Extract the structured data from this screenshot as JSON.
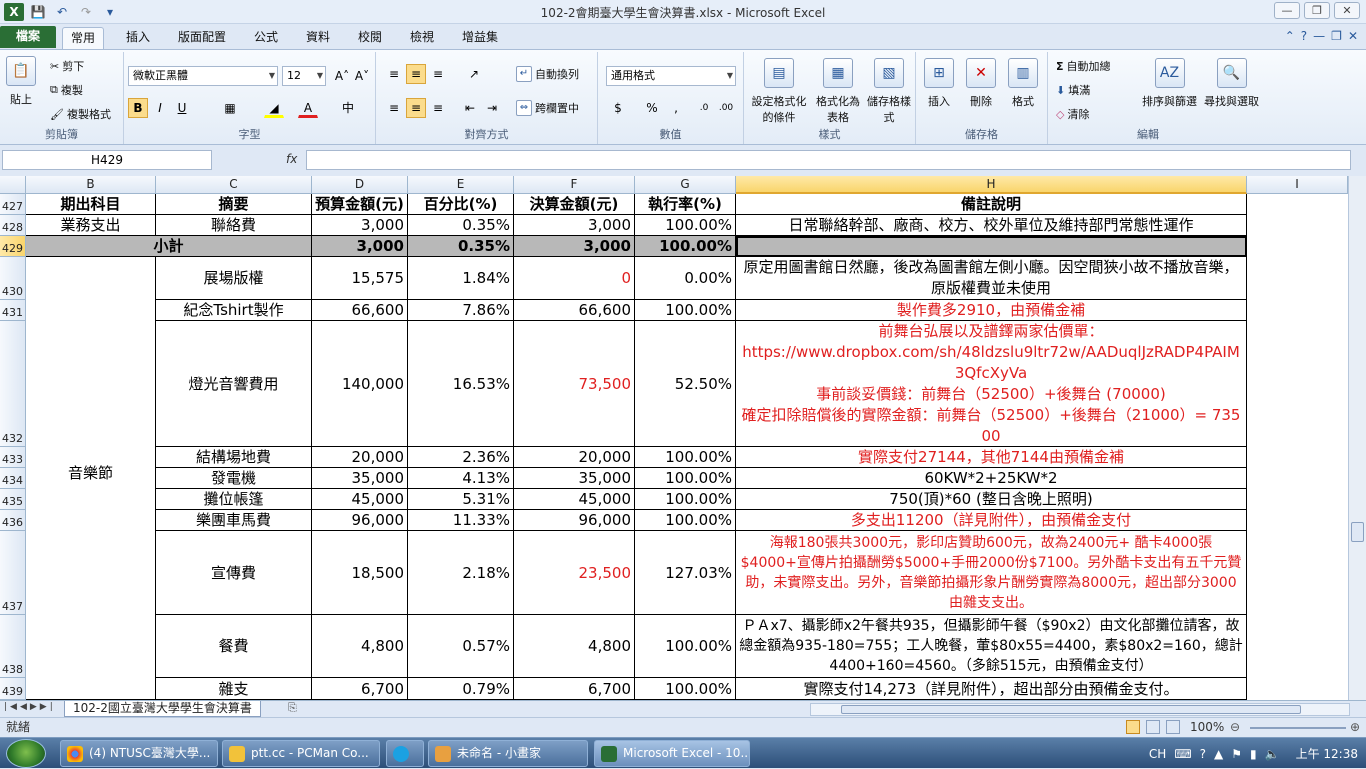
{
  "window": {
    "title": "102-2會期臺大學生會決算書.xlsx - Microsoft Excel"
  },
  "ribbon_tabs": [
    "檔案",
    "常用",
    "插入",
    "版面配置",
    "公式",
    "資料",
    "校閱",
    "檢視",
    "增益集"
  ],
  "ribbon": {
    "clipboard": {
      "paste": "貼上",
      "cut": "剪下",
      "copy": "複製",
      "format_painter": "複製格式",
      "label": "剪貼簿"
    },
    "font": {
      "name": "微軟正黑體",
      "size": "12",
      "label": "字型"
    },
    "alignment": {
      "wrap": "自動換列",
      "merge": "跨欄置中",
      "label": "對齊方式"
    },
    "number": {
      "format": "通用格式",
      "label": "數值"
    },
    "styles": {
      "conditional": "設定格式化的條件",
      "table": "格式化為表格",
      "cell": "儲存格樣式",
      "label": "樣式"
    },
    "cells": {
      "insert": "插入",
      "delete": "刪除",
      "format": "格式",
      "label": "儲存格"
    },
    "editing": {
      "autosum": "自動加總",
      "fill": "填滿",
      "clear": "清除",
      "sort": "排序與篩選",
      "find": "尋找與選取",
      "label": "編輯"
    }
  },
  "formula_bar": {
    "name_box": "H429",
    "fx": "fx",
    "value": ""
  },
  "columns": [
    "B",
    "C",
    "D",
    "E",
    "F",
    "G",
    "H",
    "I"
  ],
  "rows": {
    "r427": {
      "num": "427",
      "b": "期出科目",
      "c": "摘要",
      "d": "預算金額(元)",
      "e": "百分比(%)",
      "f": "決算金額(元)",
      "g": "執行率(%)",
      "h": "備註說明"
    },
    "r428": {
      "num": "428",
      "b": "業務支出",
      "c": "聯絡費",
      "d": "3,000",
      "e": "0.35%",
      "f": "3,000",
      "g": "100.00%",
      "h": "日常聯絡幹部、廠商、校方、校外單位及維持部門常態性運作"
    },
    "r429": {
      "num": "429",
      "bc": "小計",
      "d": "3,000",
      "e": "0.35%",
      "f": "3,000",
      "g": "100.00%",
      "h": ""
    },
    "r430": {
      "num": "430",
      "c": "展場版權",
      "d": "15,575",
      "e": "1.84%",
      "f": "0",
      "g": "0.00%",
      "h": "原定用圖書館日然廳，後改為圖書館左側小廳。因空間狹小故不播放音樂，原版權費並未使用"
    },
    "r431": {
      "num": "431",
      "c": "紀念Tshirt製作",
      "d": "66,600",
      "e": "7.86%",
      "f": "66,600",
      "g": "100.00%",
      "h": "製作費多2910，由預備金補"
    },
    "r432": {
      "num": "432",
      "c": "燈光音響費用",
      "d": "140,000",
      "e": "16.53%",
      "f": "73,500",
      "g": "52.50%",
      "h1": "前舞台弘展以及譜鐸兩家估價單：",
      "h2": "https://www.dropbox.com/sh/48ldzslu9ltr72w/AADuqlJzRADP4PAIM3QfcXyVa",
      "h3": "事前談妥價錢：前舞台（52500）+後舞台 (70000)",
      "h4": "確定扣除賠償後的實際金額：前舞台（52500）+後舞台（21000）= 73500"
    },
    "r433": {
      "num": "433",
      "c": "結構場地費",
      "d": "20,000",
      "e": "2.36%",
      "f": "20,000",
      "g": "100.00%",
      "h": "實際支付27144，其他7144由預備金補"
    },
    "r434": {
      "num": "434",
      "c": "發電機",
      "d": "35,000",
      "e": "4.13%",
      "f": "35,000",
      "g": "100.00%",
      "h": "60KW*2+25KW*2"
    },
    "r435": {
      "num": "435",
      "c": "攤位帳篷",
      "d": "45,000",
      "e": "5.31%",
      "f": "45,000",
      "g": "100.00%",
      "h": "750(頂)*60 (整日含晚上照明)"
    },
    "r436": {
      "num": "436",
      "c": "樂團車馬費",
      "d": "96,000",
      "e": "11.33%",
      "f": "96,000",
      "g": "100.00%",
      "h": "多支出11200（詳見附件），由預備金支付"
    },
    "r437": {
      "num": "437",
      "c": "宣傳費",
      "d": "18,500",
      "e": "2.18%",
      "f": "23,500",
      "g": "127.03%",
      "h": "海報180張共3000元，影印店贊助600元，故為2400元+ 酷卡4000張$4000+宣傳片拍攝酬勞$5000+手冊2000份$7100。另外酷卡支出有五千元贊助，未實際支出。另外，音樂節拍攝形象片酬勞實際為8000元，超出部分3000由雜支支出。"
    },
    "r438": {
      "num": "438",
      "c": "餐費",
      "d": "4,800",
      "e": "0.57%",
      "f": "4,800",
      "g": "100.00%",
      "h": "ＰＡx7、攝影師x2午餐共935，但攝影師午餐（$90x2）由文化部攤位請客，故總金額為935-180=755；工人晚餐，葷$80x55=4400，素$80x2=160，總計4400+160=4560。（多餘515元，由預備金支付）"
    },
    "r439": {
      "num": "439",
      "c": "雜支",
      "d": "6,700",
      "e": "0.79%",
      "f": "6,700",
      "g": "100.00%",
      "h": "實際支付14,273（詳見附件），超出部分由預備金支付。"
    },
    "music_fest": "音樂節"
  },
  "sheet_tab": "102-2國立臺灣大學學生會決算書",
  "status": {
    "ready": "就緒",
    "zoom": "100%"
  },
  "taskbar": {
    "items": [
      "(4) NTUSC臺灣大學...",
      "ptt.cc - PCMan Co...",
      "未命名 - 小畫家",
      "Microsoft Excel - 10..."
    ],
    "lang": "CH",
    "time": "上午 12:38"
  },
  "colors": {
    "accent": "#2a6e35",
    "red_text": "#e02020",
    "subtotal_bg": "#b8b8b8",
    "selected_header": "#f9d56c"
  }
}
